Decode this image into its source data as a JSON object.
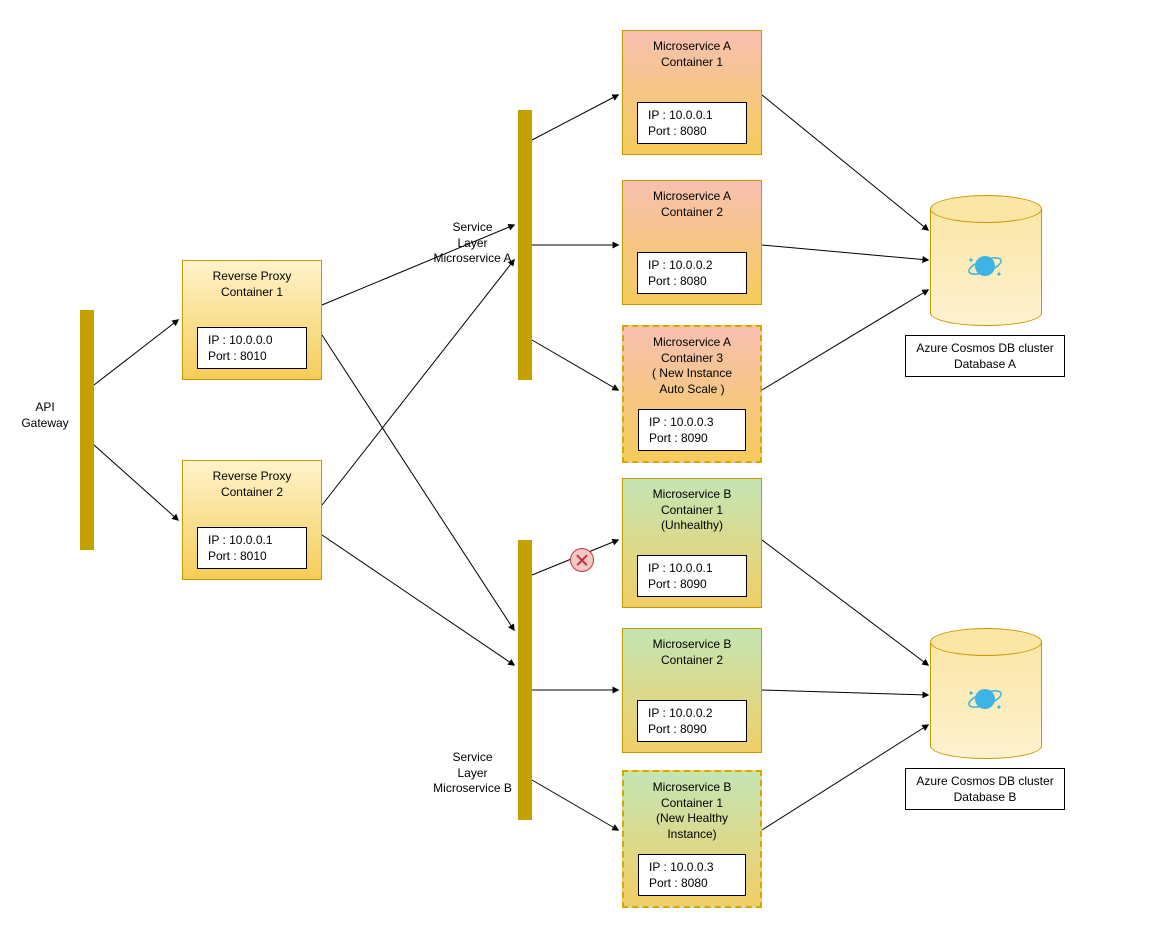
{
  "api_gateway": {
    "label": "API\nGateway"
  },
  "service_a_bar": {
    "label": "Service\nLayer\nMicroservice A"
  },
  "service_b_bar": {
    "label": "Service\nLayer\nMicroservice B"
  },
  "reverse_proxy": {
    "c1": {
      "title": "Reverse Proxy\nContainer 1",
      "ip": "IP : 10.0.0.0",
      "port": "Port : 8010"
    },
    "c2": {
      "title": "Reverse Proxy\nContainer 2",
      "ip": "IP : 10.0.0.1",
      "port": "Port : 8010"
    }
  },
  "ms_a": {
    "c1": {
      "title": "Microservice A\nContainer 1",
      "ip": "IP : 10.0.0.1",
      "port": "Port : 8080"
    },
    "c2": {
      "title": "Microservice A\nContainer 2",
      "ip": "IP : 10.0.0.2",
      "port": "Port : 8080"
    },
    "c3": {
      "title": "Microservice A\nContainer 3\n( New Instance\nAuto Scale )",
      "ip": "IP : 10.0.0.3",
      "port": "Port : 8090"
    }
  },
  "ms_b": {
    "c1": {
      "title": "Microservice B\nContainer 1\n(Unhealthy)",
      "ip": "IP : 10.0.0.1",
      "port": "Port : 8090"
    },
    "c2": {
      "title": "Microservice B\nContainer 2",
      "ip": "IP : 10.0.0.2",
      "port": "Port : 8090"
    },
    "c3": {
      "title": "Microservice B\nContainer 1\n(New Healthy\nInstance)",
      "ip": "IP : 10.0.0.3",
      "port": "Port : 8080"
    }
  },
  "db": {
    "a": {
      "label": "Azure Cosmos DB cluster\nDatabase A"
    },
    "b": {
      "label": "Azure Cosmos DB cluster\nDatabase B"
    }
  },
  "colors": {
    "bar": "#c5a100"
  }
}
